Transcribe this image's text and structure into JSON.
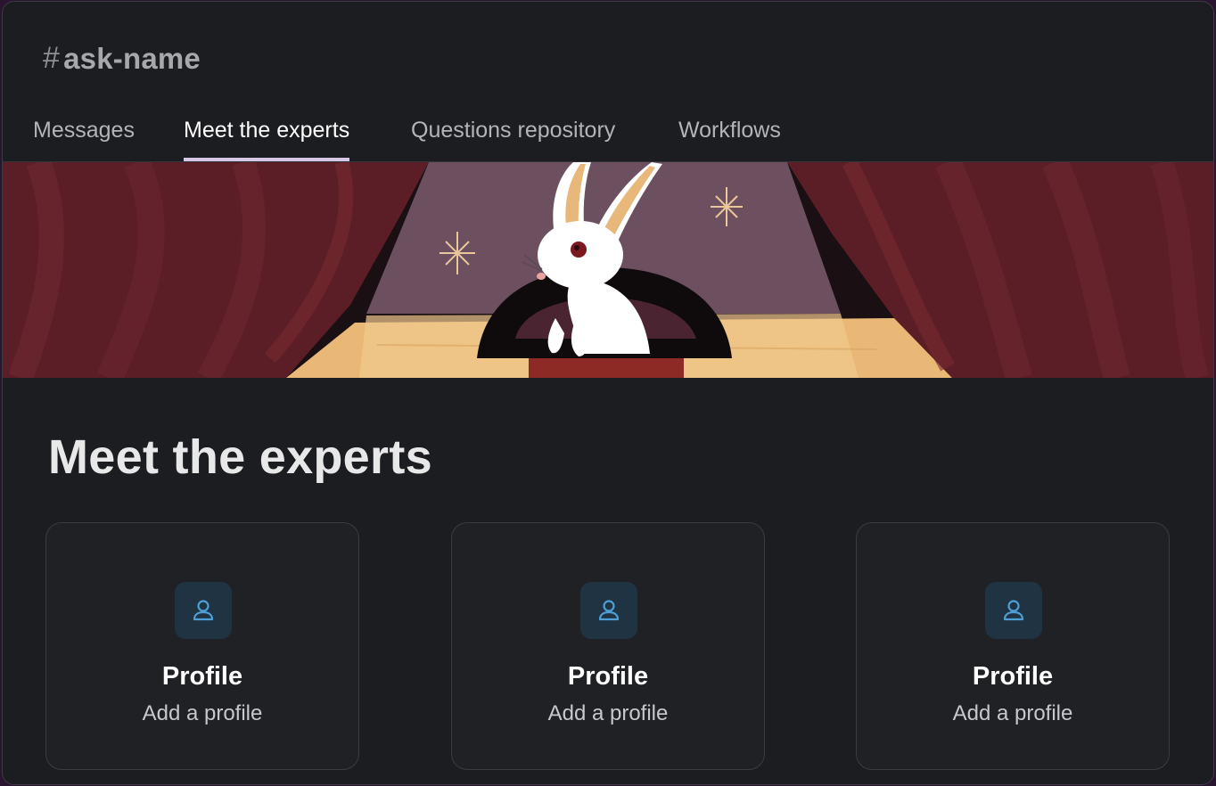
{
  "channel": {
    "hash": "#",
    "name": "ask-name"
  },
  "tabs": [
    {
      "label": "Messages",
      "active": false
    },
    {
      "label": "Meet the experts",
      "active": true
    },
    {
      "label": "Questions repository",
      "active": false
    },
    {
      "label": "Workflows",
      "active": false
    }
  ],
  "banner": {
    "illustration": "magician-rabbit-in-hat-on-stage"
  },
  "section": {
    "title": "Meet the experts"
  },
  "cards": [
    {
      "icon": "user-icon",
      "title": "Profile",
      "subtitle": "Add a profile"
    },
    {
      "icon": "user-icon",
      "title": "Profile",
      "subtitle": "Add a profile"
    },
    {
      "icon": "user-icon",
      "title": "Profile",
      "subtitle": "Add a profile"
    }
  ],
  "colors": {
    "background": "#1c1d21",
    "card": "#202125",
    "icon_box": "#1f3343",
    "icon": "#4d9fd6",
    "active_tab_underline": "#d8c8e8"
  }
}
